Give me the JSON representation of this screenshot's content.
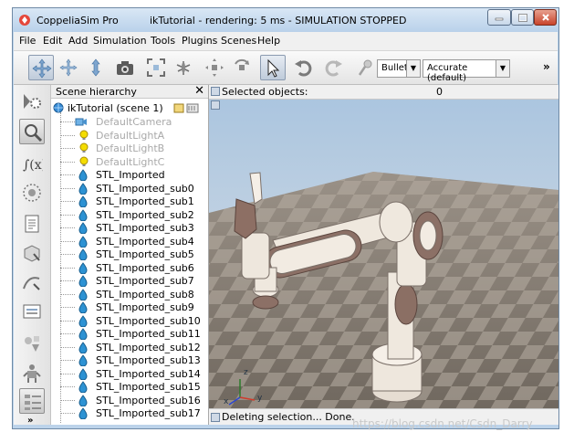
{
  "window": {
    "app_title": "CoppeliaSim Pro",
    "doc_title": "ikTutorial - rendering: 5 ms - SIMULATION STOPPED",
    "controls": [
      "minimize",
      "maximize",
      "close"
    ]
  },
  "menu": [
    "File",
    "Edit",
    "Add",
    "Simulation",
    "Tools",
    "Plugins",
    "Scenes",
    "Help"
  ],
  "toolbar": {
    "buttons": [
      "move-camera-icon",
      "rotate-camera-icon",
      "zoom-camera-icon",
      "screenshot-camera-icon",
      "fit-view-icon",
      "fly-icon",
      "object-shift-icon",
      "object-rotate-icon",
      "select-pointer-icon",
      "undo-icon",
      "redo-icon",
      "physics-engine-icon"
    ],
    "engine": "Bullet",
    "accuracy": "Accurate (default)",
    "more": "»"
  },
  "sidebar_icons": [
    "model-browser-icon",
    "scene-hierarchy-icon",
    "calculation-modules-icon",
    "collections-icon",
    "scripts-icon",
    "shapes-edit-icon",
    "path-edit-icon",
    "selection-icon",
    "models-icon",
    "robot-icon",
    "layers-icon"
  ],
  "sidebar_more": "»",
  "hierarchy": {
    "title": "Scene hierarchy",
    "close": "✕",
    "scene": "ikTutorial (scene 1)",
    "items": [
      {
        "label": "DefaultCamera",
        "icon": "camera-icon",
        "dim": true
      },
      {
        "label": "DefaultLightA",
        "icon": "light-icon",
        "dim": true
      },
      {
        "label": "DefaultLightB",
        "icon": "light-icon",
        "dim": true
      },
      {
        "label": "DefaultLightC",
        "icon": "light-icon",
        "dim": true
      },
      {
        "label": "STL_Imported",
        "icon": "shape-icon",
        "dim": false
      },
      {
        "label": "STL_Imported_sub0",
        "icon": "shape-icon",
        "dim": false
      },
      {
        "label": "STL_Imported_sub1",
        "icon": "shape-icon",
        "dim": false
      },
      {
        "label": "STL_Imported_sub2",
        "icon": "shape-icon",
        "dim": false
      },
      {
        "label": "STL_Imported_sub3",
        "icon": "shape-icon",
        "dim": false
      },
      {
        "label": "STL_Imported_sub4",
        "icon": "shape-icon",
        "dim": false
      },
      {
        "label": "STL_Imported_sub5",
        "icon": "shape-icon",
        "dim": false
      },
      {
        "label": "STL_Imported_sub6",
        "icon": "shape-icon",
        "dim": false
      },
      {
        "label": "STL_Imported_sub7",
        "icon": "shape-icon",
        "dim": false
      },
      {
        "label": "STL_Imported_sub8",
        "icon": "shape-icon",
        "dim": false
      },
      {
        "label": "STL_Imported_sub9",
        "icon": "shape-icon",
        "dim": false
      },
      {
        "label": "STL_Imported_sub10",
        "icon": "shape-icon",
        "dim": false
      },
      {
        "label": "STL_Imported_sub11",
        "icon": "shape-icon",
        "dim": false
      },
      {
        "label": "STL_Imported_sub12",
        "icon": "shape-icon",
        "dim": false
      },
      {
        "label": "STL_Imported_sub13",
        "icon": "shape-icon",
        "dim": false
      },
      {
        "label": "STL_Imported_sub14",
        "icon": "shape-icon",
        "dim": false
      },
      {
        "label": "STL_Imported_sub15",
        "icon": "shape-icon",
        "dim": false
      },
      {
        "label": "STL_Imported_sub16",
        "icon": "shape-icon",
        "dim": false
      },
      {
        "label": "STL_Imported_sub17",
        "icon": "shape-icon",
        "dim": false
      }
    ]
  },
  "viewport": {
    "selected_label": "Selected objects:",
    "selected_count": "0",
    "status": "Deleting selection... Done.",
    "axes": {
      "x": "x",
      "y": "y",
      "z": "z"
    }
  },
  "watermark": "https://blog.csdn.net/Csdn_Darry",
  "colors": {
    "titlebar": "#bcd3ea",
    "shape_icon": "#1e88c8",
    "light_icon": "#f2d300",
    "robot_body": "#efe8dc",
    "robot_accent": "#8a6f63"
  }
}
